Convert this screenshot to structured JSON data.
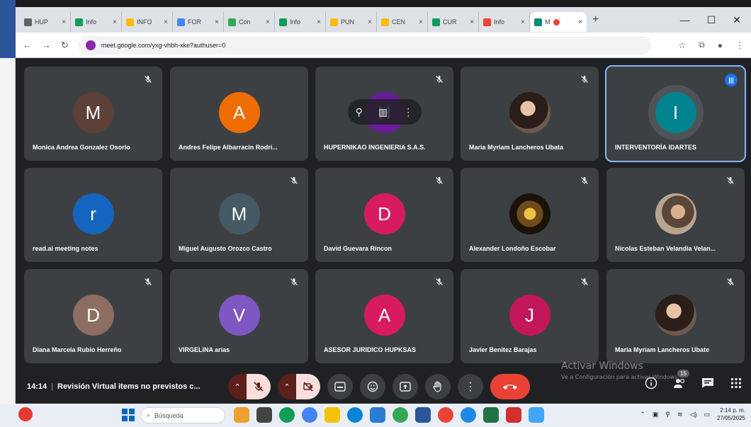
{
  "browser": {
    "tabs": [
      {
        "label": "HUP",
        "color": "#5f6368"
      },
      {
        "label": "Info",
        "color": "#0f9d58"
      },
      {
        "label": "INFO",
        "color": "#fbbc04"
      },
      {
        "label": "FOR",
        "color": "#4285f4"
      },
      {
        "label": "Con",
        "color": "#34a853"
      },
      {
        "label": "Info",
        "color": "#0f9d58"
      },
      {
        "label": "PUN",
        "color": "#fbbc04"
      },
      {
        "label": "CEN",
        "color": "#fbbc04"
      },
      {
        "label": "CUR",
        "color": "#0f9d58"
      },
      {
        "label": "Info",
        "color": "#ea4335"
      }
    ],
    "active_tab": {
      "label": "M"
    },
    "new_tab": "+",
    "url": "meet.google.com/yxg-vhbh-xke?authuser=0"
  },
  "participants": [
    {
      "name": "Monica Andrea Gonzalez Osorio",
      "initial": "M",
      "color": "#5d4037",
      "muted": true
    },
    {
      "name": "Andres Felipe Albarracin Rodri...",
      "initial": "A",
      "color": "#ef6c00",
      "muted": false
    },
    {
      "name": "HUPERNIKAO INGENIERIA S.A.S.",
      "initial": "H",
      "color": "#6a1b9a",
      "muted": true,
      "hover": true
    },
    {
      "name": "Maria Myriam Lancheros Ubata",
      "initial": "",
      "photo": "photo",
      "muted": true
    },
    {
      "name": "INTERVENTORÍA IDARTES",
      "initial": "I",
      "color": "#00838f",
      "muted": false,
      "speaking": true
    },
    {
      "name": "read.ai meeting notes",
      "initial": "r",
      "color": "#1565c0",
      "muted": false
    },
    {
      "name": "Miguel Augusto Orozco Castro",
      "initial": "M",
      "color": "#455a64",
      "muted": true
    },
    {
      "name": "David Guevara Rincon",
      "initial": "D",
      "color": "#d81b60",
      "muted": true
    },
    {
      "name": "Alexander Londoño Escobar",
      "initial": "",
      "photo": "photo2",
      "muted": true
    },
    {
      "name": "Nicolas Esteban Velandia Velan...",
      "initial": "",
      "photo": "photo3",
      "muted": true
    },
    {
      "name": "Diana Marcela Rubio Herreño",
      "initial": "D",
      "color": "#8d6e63",
      "muted": true
    },
    {
      "name": "VIRGELINA arias",
      "initial": "V",
      "color": "#7e57c2",
      "muted": true
    },
    {
      "name": "ASESOR JURIDICO HUPKSAS",
      "initial": "A",
      "color": "#d81b60",
      "muted": true
    },
    {
      "name": "Javier Benitez Barajas",
      "initial": "J",
      "color": "#c2185b",
      "muted": true
    },
    {
      "name": "Maria Myriam Lancheros Ubate",
      "initial": "",
      "photo": "photo",
      "muted": true
    }
  ],
  "meeting": {
    "time": "14:14",
    "separator": "|",
    "title": "Revisión Virtual items no previstos c..."
  },
  "people_count": "15",
  "watermark": {
    "line1": "Activar Windows",
    "line2": "Ve a Configuración para activar Windows."
  },
  "taskbar": {
    "search_placeholder": "Búsqueda",
    "clock_time": "2:14 p. m.",
    "clock_date": "27/05/2025"
  },
  "colors": {
    "hangup": "#ea4335",
    "speaking_outline": "#8ab4f8"
  }
}
